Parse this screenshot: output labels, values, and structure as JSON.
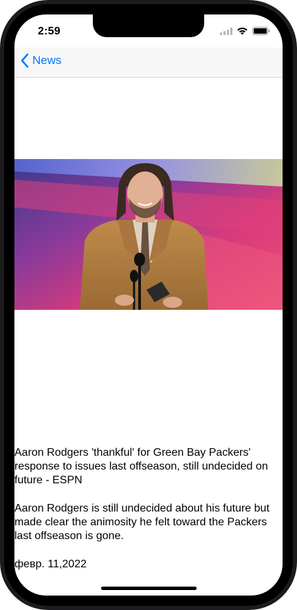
{
  "status_bar": {
    "time": "2:59"
  },
  "nav": {
    "back_label": "News"
  },
  "article": {
    "title": "Aaron Rodgers 'thankful' for Green Bay Packers' response to issues last offseason, still undecided on future - ESPN",
    "description": "Aaron Rodgers is still undecided about his future but made clear the animosity he felt toward the Packers last offseason is gone.",
    "date": "февр. 11,2022"
  },
  "colors": {
    "accent": "#007aff",
    "nav_background": "#f7f7f7"
  },
  "icons": {
    "back": "chevron-left-icon",
    "signal": "cellular-signal-icon",
    "wifi": "wifi-icon",
    "battery": "battery-icon"
  }
}
